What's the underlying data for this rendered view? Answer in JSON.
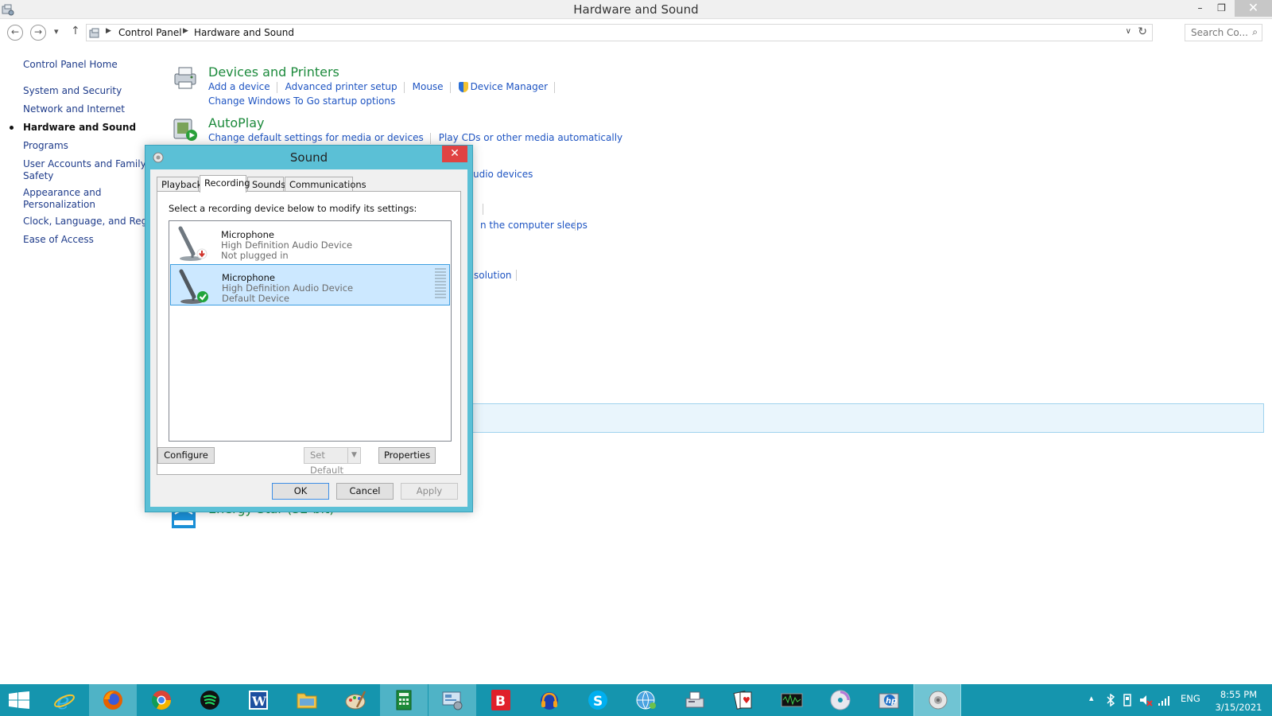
{
  "window": {
    "title": "Hardware and Sound",
    "minimize": "–",
    "restore": "❐",
    "close": "✕"
  },
  "nav": {
    "back": "←",
    "forward": "→",
    "recent": "▾",
    "up": "↑",
    "breadcrumbs": [
      "Control Panel",
      "Hardware and Sound"
    ],
    "breadcrumb_separator": "▶",
    "address_dropdown": "∨",
    "refresh": "↻",
    "search_placeholder": "Search Co...",
    "search_icon": "⌕"
  },
  "sidebar": {
    "items": [
      {
        "label": "Control Panel Home"
      },
      {
        "label": "System and Security"
      },
      {
        "label": "Network and Internet"
      },
      {
        "label": "Hardware and Sound"
      },
      {
        "label": "Programs"
      },
      {
        "label": "User Accounts and Family"
      },
      {
        "label": "Safety"
      },
      {
        "label": "Appearance and"
      },
      {
        "label": "Personalization"
      },
      {
        "label": "Clock, Language, and Region"
      },
      {
        "label": "Ease of Access"
      }
    ]
  },
  "categories": {
    "devices": {
      "title": "Devices and Printers",
      "links": [
        "Add a device",
        "Advanced printer setup",
        "Mouse",
        "Device Manager"
      ],
      "links2": [
        "Change Windows To Go startup options"
      ]
    },
    "autoplay": {
      "title": "AutoPlay",
      "links": [
        "Change default settings for media or devices",
        "Play CDs or other media automatically"
      ]
    },
    "energy": {
      "title": "Energy Star (32-bit)"
    },
    "fragments": {
      "sound": "udio devices",
      "power": "n the computer sleeps",
      "display": "solution"
    }
  },
  "dialog": {
    "title": "Sound",
    "close": "✕",
    "tabs": [
      "Playback",
      "Recording",
      "Sounds",
      "Communications"
    ],
    "selected_tab": "Recording",
    "instruction": "Select a recording device below to modify its settings:",
    "devices": [
      {
        "name": "Microphone",
        "driver": "High Definition Audio Device",
        "status": "Not plugged in",
        "status_icon": "down-arrow-red-icon"
      },
      {
        "name": "Microphone",
        "driver": "High Definition Audio Device",
        "status": "Default Device",
        "status_icon": "check-green-icon",
        "selected": true
      }
    ],
    "buttons": {
      "configure": "Configure",
      "set_default": "Set Default",
      "properties": "Properties",
      "ok": "OK",
      "cancel": "Cancel",
      "apply": "Apply"
    }
  },
  "taskbar": {
    "apps": [
      "start",
      "internet-explorer",
      "firefox",
      "chrome",
      "spotify",
      "word",
      "file-explorer",
      "paint",
      "calculator",
      "control-panel",
      "bitdefender",
      "audacity",
      "skype",
      "network",
      "fax",
      "solitaire",
      "sound-recorder",
      "dvd",
      "hp",
      "sound"
    ],
    "tray": {
      "expand": "▴",
      "language": "ENG"
    },
    "clock": {
      "time": "8:55 PM",
      "date": "3/15/2021"
    }
  },
  "colors": {
    "accent": "#1595ae",
    "dialog_frame": "#5bc0d6",
    "link": "#1e54c2",
    "category_title": "#1c8a3c",
    "close_red": "#e04343"
  }
}
